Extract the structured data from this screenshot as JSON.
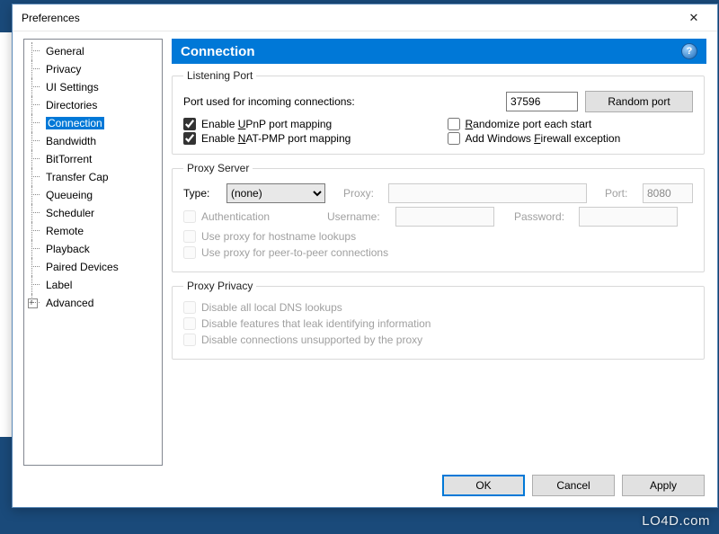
{
  "window": {
    "title": "Preferences"
  },
  "sidebar": {
    "items": [
      {
        "label": "General"
      },
      {
        "label": "Privacy"
      },
      {
        "label": "UI Settings"
      },
      {
        "label": "Directories"
      },
      {
        "label": "Connection",
        "selected": true
      },
      {
        "label": "Bandwidth"
      },
      {
        "label": "BitTorrent"
      },
      {
        "label": "Transfer Cap"
      },
      {
        "label": "Queueing"
      },
      {
        "label": "Scheduler"
      },
      {
        "label": "Remote"
      },
      {
        "label": "Playback"
      },
      {
        "label": "Paired Devices"
      },
      {
        "label": "Label"
      },
      {
        "label": "Advanced",
        "expandable": true
      }
    ]
  },
  "header": {
    "title": "Connection"
  },
  "listening_port": {
    "legend": "Listening Port",
    "port_label": "Port used for incoming connections:",
    "port_value": "37596",
    "random_btn": "Random port",
    "upnp": "Enable UPnP port mapping",
    "upnp_accel": "U",
    "natpmp": "Enable NAT-PMP port mapping",
    "natpmp_accel": "N",
    "randomize": "Randomize port each start",
    "randomize_accel": "R",
    "firewall": "Add Windows Firewall exception",
    "firewall_accel": "F"
  },
  "proxy_server": {
    "legend": "Proxy Server",
    "type_label": "Type:",
    "type_value": "(none)",
    "proxy_label": "Proxy:",
    "port_label": "Port:",
    "port_value": "8080",
    "auth": "Authentication",
    "user_label": "Username:",
    "pass_label": "Password:",
    "hostname_lookups": "Use proxy for hostname lookups",
    "p2p": "Use proxy for peer-to-peer connections"
  },
  "proxy_privacy": {
    "legend": "Proxy Privacy",
    "dns": "Disable all local DNS lookups",
    "leak": "Disable features that leak identifying information",
    "unsupported": "Disable connections unsupported by the proxy"
  },
  "buttons": {
    "ok": "OK",
    "cancel": "Cancel",
    "apply": "Apply"
  },
  "watermark": "LO4D.com"
}
